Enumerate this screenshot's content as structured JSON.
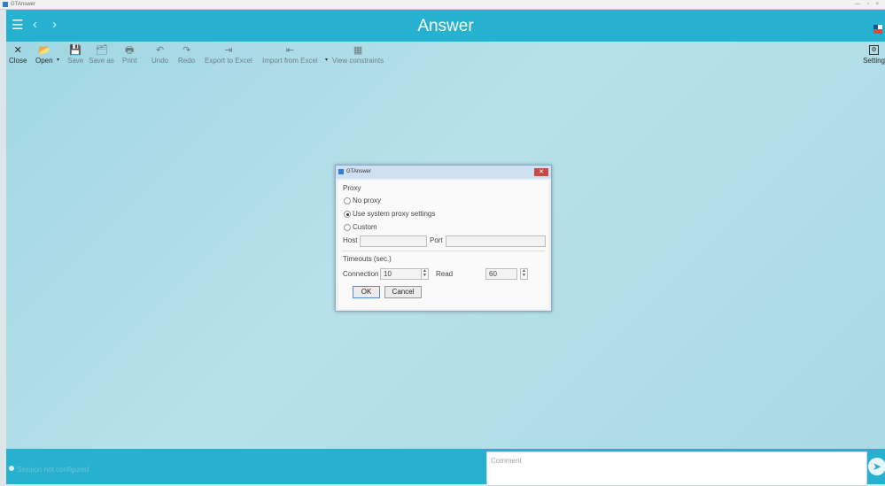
{
  "os_window": {
    "title": "GTAnswer",
    "controls": "— ▫ ×"
  },
  "header": {
    "title": "Answer"
  },
  "icons": {
    "menu": "☰",
    "back": "‹",
    "forward": "›",
    "close": "✕",
    "open": "📂",
    "save": "💾",
    "save_as": "🗂",
    "print": "🖶",
    "undo": "↶",
    "redo": "↷",
    "export": "⇥",
    "import": "⇤",
    "constraints": "▦",
    "settings": "⚙",
    "send": "➤"
  },
  "toolbar": {
    "close": "Close",
    "open": "Open",
    "save": "Save",
    "save_as": "Save as",
    "print": "Print",
    "undo": "Undo",
    "redo": "Redo",
    "export_excel": "Export to Excel",
    "import_excel": "Import from Excel",
    "view_constraints": "View constraints",
    "settings": "Setting"
  },
  "dialog": {
    "title": "GTAnswer",
    "close_icon": "✕",
    "proxy_heading": "Proxy",
    "options": [
      "No proxy",
      "Use system proxy settings",
      "Custom"
    ],
    "selected_option": "Use system proxy settings",
    "host_label": "Host",
    "host_value": "",
    "port_label": "Port",
    "port_value": "",
    "timeouts_heading": "Timeouts (sec.)",
    "connection_label": "Connection",
    "connection_value": "10",
    "read_label": "Read",
    "read_value": "60",
    "spin_up": "▲",
    "spin_down": "▼",
    "ok_label": "OK",
    "cancel_label": "Cancel"
  },
  "status": {
    "text": "Session not configured",
    "comment_placeholder": "Comment"
  },
  "colors": {
    "accent": "#25b1cf",
    "background": "#a9d9e4"
  }
}
